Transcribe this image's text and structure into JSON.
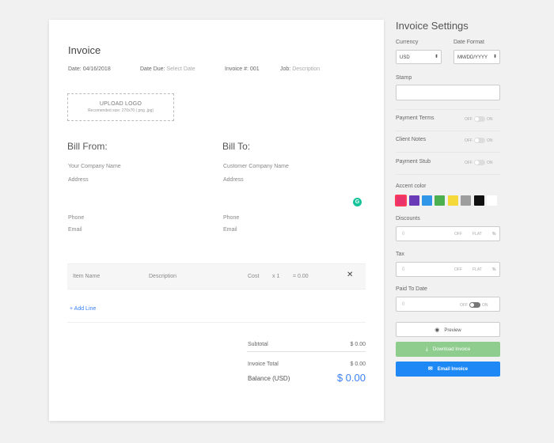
{
  "invoice": {
    "title": "Invoice",
    "date_label": "Date:",
    "date_value": "04/16/2018",
    "due_label": "Date Due:",
    "due_placeholder": "Select Date",
    "number_label": "Invoice #:",
    "number_value": "001",
    "job_label": "Job:",
    "job_placeholder": "Description",
    "upload_title": "UPLOAD LOGO",
    "upload_hint": "Recomended size: 270x70 (.png .jpg)",
    "bill_from": {
      "heading": "Bill From:",
      "company": "Your Company Name",
      "address": "Address",
      "phone": "Phone",
      "email": "Email"
    },
    "bill_to": {
      "heading": "Bill To:",
      "company": "Customer Company Name",
      "address": "Address",
      "phone": "Phone",
      "email": "Email"
    },
    "line_item": {
      "name": "Item Name",
      "description": "Description",
      "cost": "Cost",
      "qty": "x 1",
      "amount": "= 0.00",
      "remove": "✕"
    },
    "add_line": "+ Add Line",
    "subtotal_label": "Subtotal",
    "subtotal_value": "$ 0.00",
    "total_label": "Invoice Total",
    "total_value": "$ 0.00",
    "balance_label": "Balance (USD)",
    "balance_value": "$ 0.00"
  },
  "settings": {
    "title": "Invoice Settings",
    "currency_label": "Currency",
    "currency_value": "USD",
    "date_format_label": "Date Format",
    "date_format_value": "MM/DD/YYYY",
    "stamp_label": "Stamp",
    "payment_terms_label": "Payment Terms",
    "client_notes_label": "Client Notes",
    "payment_stub_label": "Payment Stub",
    "toggle_off": "OFF",
    "toggle_on": "ON",
    "accent_label": "Accent color",
    "accent_colors": [
      "#e8336d",
      "#6a3bb7",
      "#2f96e8",
      "#4caf50",
      "#f5d93b",
      "#9e9e9e",
      "#111111",
      "#ffffff"
    ],
    "discounts_label": "Discounts",
    "tax_label": "Tax",
    "paid_label": "Paid To Date",
    "input_placeholder": "0",
    "flat": "FLAT",
    "percent": "%",
    "preview": "Preview",
    "download": "Download Invoice",
    "email": "Email Invoice"
  }
}
